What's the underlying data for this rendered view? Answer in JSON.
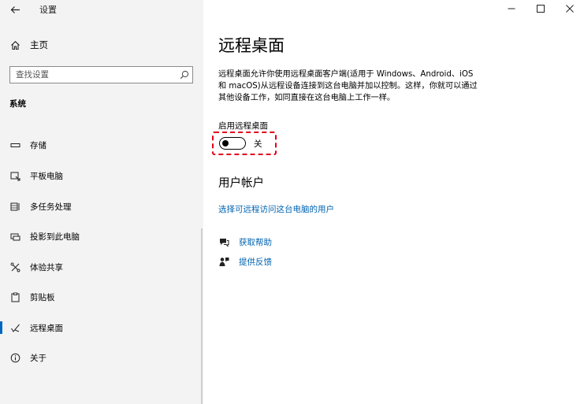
{
  "window": {
    "title": "设置"
  },
  "sidebar": {
    "home_label": "主页",
    "search_placeholder": "查找设置",
    "section_title": "系统",
    "items": [
      {
        "label": "存储",
        "icon": "storage-icon"
      },
      {
        "label": "平板电脑",
        "icon": "tablet-icon"
      },
      {
        "label": "多任务处理",
        "icon": "multitasking-icon"
      },
      {
        "label": "投影到此电脑",
        "icon": "projecting-icon"
      },
      {
        "label": "体验共享",
        "icon": "shared-experiences-icon"
      },
      {
        "label": "剪贴板",
        "icon": "clipboard-icon"
      },
      {
        "label": "远程桌面",
        "icon": "remote-desktop-icon",
        "selected": true
      },
      {
        "label": "关于",
        "icon": "info-icon"
      }
    ]
  },
  "main": {
    "title": "远程桌面",
    "description_lines": [
      "远程桌面允许你使用远程桌面客户端(适用于 Windows、Android、iOS",
      "和 macOS)从远程设备连接到这台电脑并加以控制。这样，你就可以通过",
      "其他设备工作，如同直接在这台电脑上工作一样。"
    ],
    "toggle_label": "启用远程桌面",
    "toggle_state": "关",
    "toggle_on": false,
    "user_accounts_heading": "用户帐户",
    "user_accounts_link": "选择可远程访问这台电脑的用户",
    "help_label": "获取帮助",
    "feedback_label": "提供反馈"
  },
  "colors": {
    "sidebar_bg": "#f3f3f3",
    "accent": "#0067c0",
    "link": "#0063b1",
    "highlight": "#e0001a"
  }
}
